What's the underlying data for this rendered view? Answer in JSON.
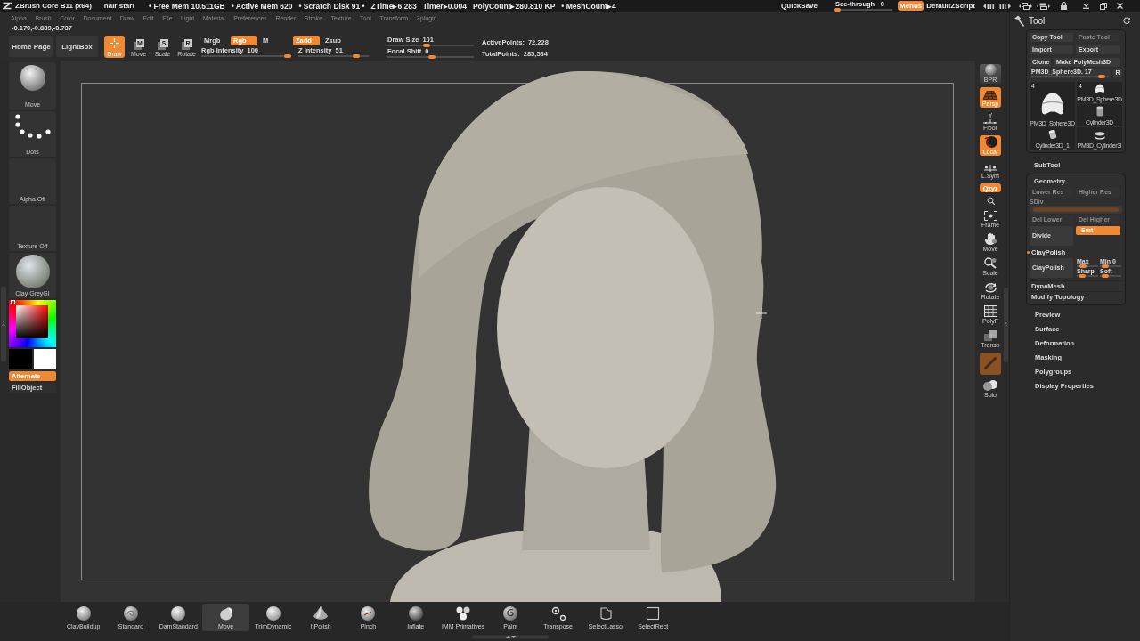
{
  "title_bar": {
    "app_name": "ZBrush Core B11 (x64)",
    "document": "hair start",
    "stats": [
      "• Free Mem 10.511GB",
      "• Active Mem 620",
      "• Scratch Disk 91 •",
      "ZTime▸6.283",
      "Timer▸0.004",
      "PolyCount▸280.810 KP",
      "• MeshCount▸4"
    ],
    "quicksave": "QuickSave",
    "see_through": {
      "label": "See-through",
      "value": "0",
      "level": 0
    },
    "menus": {
      "label": "Menus",
      "on": true
    },
    "script": "DefaultZScript"
  },
  "menu_bar": [
    "Alpha",
    "Brush",
    "Color",
    "Document",
    "Draw",
    "Edit",
    "File",
    "Light",
    "Material",
    "Preferences",
    "Render",
    "Stroke",
    "Texture",
    "Tool",
    "Transform",
    "Zplugin"
  ],
  "coordinates": "-0.179,-0.889,-0.737",
  "top_shelf": {
    "nav": [
      "Home Page",
      "LightBox"
    ],
    "modes": [
      {
        "label": "Draw",
        "selected": true
      },
      {
        "label": "Move",
        "glyph": "M",
        "selected": false
      },
      {
        "label": "Scale",
        "glyph": "S",
        "selected": false
      },
      {
        "label": "Rotate",
        "glyph": "R",
        "selected": false
      }
    ],
    "color_modes": [
      {
        "label": "Mrgb",
        "on": false
      },
      {
        "label": "Rgb",
        "on": true
      },
      {
        "label": "M",
        "on": false
      }
    ],
    "rgb_intensity": {
      "label": "Rgb Intensity",
      "value": "100",
      "level": 1
    },
    "z_modes": [
      {
        "label": "Zadd",
        "on": true
      },
      {
        "label": "Zsub",
        "on": false
      }
    ],
    "z_intensity": {
      "label": "Z Intensity",
      "value": "51",
      "level": 0.86
    },
    "draw_size": {
      "label": "Draw Size",
      "value": "101",
      "level": 0.45
    },
    "focal_shift": {
      "label": "Focal Shift",
      "value": "0",
      "level": 0.52
    },
    "points": [
      {
        "label": "ActivePoints:",
        "value": "72,228"
      },
      {
        "label": "TotalPoints:",
        "value": "285,584"
      }
    ]
  },
  "left_shelf": {
    "brush": "Move",
    "stroke": "Dots",
    "alpha": "Alpha Off",
    "texture": "Texture Off",
    "material": "Clay GreyGI",
    "swatches": [
      {
        "color": "#000000"
      },
      {
        "color": "#ffffff"
      }
    ],
    "alternate": {
      "label": "Alternate",
      "on": true
    },
    "fill_object": "FillObject"
  },
  "right_shelf": [
    {
      "kind": "render",
      "label": "BPR",
      "on": false
    },
    {
      "kind": "button",
      "label": "Persp",
      "on": true
    },
    {
      "kind": "button",
      "axis": "Y",
      "label": "Floor",
      "on": false
    },
    {
      "kind": "button",
      "label": "Local",
      "on": true
    },
    {
      "kind": "button",
      "label": "L.Sym",
      "on": false
    },
    {
      "kind": "toggle",
      "label": "Qxyz",
      "on": true
    },
    {
      "kind": "mini",
      "on": false
    },
    {
      "kind": "button",
      "label": "Frame",
      "on": false
    },
    {
      "kind": "button",
      "label": "Move",
      "on": false
    },
    {
      "kind": "button",
      "label": "Scale",
      "on": false
    },
    {
      "kind": "button",
      "label": "Rotate",
      "on": false
    },
    {
      "kind": "button",
      "label": "PolyF",
      "on": false
    },
    {
      "kind": "button",
      "label": "Transp",
      "on": false
    },
    {
      "kind": "tile",
      "on": true
    },
    {
      "kind": "button",
      "label": "Solo",
      "on": false
    }
  ],
  "tool_panel": {
    "title": "Tool",
    "buttons": [
      {
        "label": "Copy Tool",
        "disabled": false
      },
      {
        "label": "Paste Tool",
        "disabled": true
      },
      {
        "label": "Import",
        "disabled": false
      },
      {
        "label": "Export",
        "disabled": false
      },
      {
        "label": "Clone",
        "disabled": false
      },
      {
        "label": "Make PolyMesh3D",
        "disabled": false
      }
    ],
    "tool_slider": {
      "label": "PM3D_Sphere3D. 17",
      "level": 0.95,
      "reset": "R"
    },
    "thumbnails": [
      {
        "kind": "large",
        "count": "4",
        "label": "PM3D_Sphere3D"
      },
      {
        "kind": "small",
        "count": "4",
        "label": "PM3D_Sphere3D"
      },
      {
        "kind": "small",
        "label": "Cylinder3D"
      },
      {
        "kind": "small",
        "label": "Cylinder3D_1"
      },
      {
        "kind": "small",
        "label": "PM3D_Cylinder3I"
      }
    ],
    "subtool": "SubTool",
    "geometry": {
      "title": "Geometry",
      "buttons": [
        {
          "label": "Lower Res",
          "disabled": true
        },
        {
          "label": "Higher Res",
          "disabled": true
        }
      ],
      "sdiv": {
        "label": "SDiv",
        "disabled": true,
        "level": 1
      },
      "del_buttons": [
        {
          "label": "Del Lower",
          "disabled": true
        },
        {
          "label": "Del Higher",
          "disabled": true
        }
      ],
      "divide": "Divide",
      "smt": {
        "label": "Smt",
        "on": true
      },
      "claypolish": {
        "label": "ClayPolish",
        "on": true,
        "button": "ClayPolish",
        "sliders": [
          {
            "label": "Max",
            "level": 0.2
          },
          {
            "label": "Min",
            "value": "0",
            "level": 0.1
          },
          {
            "label": "Sharp",
            "level": 0.1
          },
          {
            "label": "Soft",
            "level": 0.1
          }
        ]
      },
      "subpalettes": [
        "DynaMesh",
        "Modify Topology"
      ]
    },
    "palettes": [
      "Preview",
      "Surface",
      "Deformation",
      "Masking",
      "Polygroups",
      "Display Properties"
    ]
  },
  "bottom_shelf": [
    {
      "label": "ClayBuildup",
      "selected": false
    },
    {
      "label": "Standard",
      "selected": false
    },
    {
      "label": "DamStandard",
      "selected": false
    },
    {
      "label": "Move",
      "selected": true
    },
    {
      "label": "TrimDynamic",
      "selected": false
    },
    {
      "label": "hPolish",
      "selected": false
    },
    {
      "label": "Pinch",
      "selected": false
    },
    {
      "label": "Inflate",
      "selected": false
    },
    {
      "label": "IMM Primatives",
      "selected": false
    },
    {
      "label": "Paint",
      "selected": false
    },
    {
      "label": "Transpose",
      "selected": false
    },
    {
      "label": "SelectLasso",
      "selected": false
    },
    {
      "label": "SelectRect",
      "selected": false
    }
  ]
}
